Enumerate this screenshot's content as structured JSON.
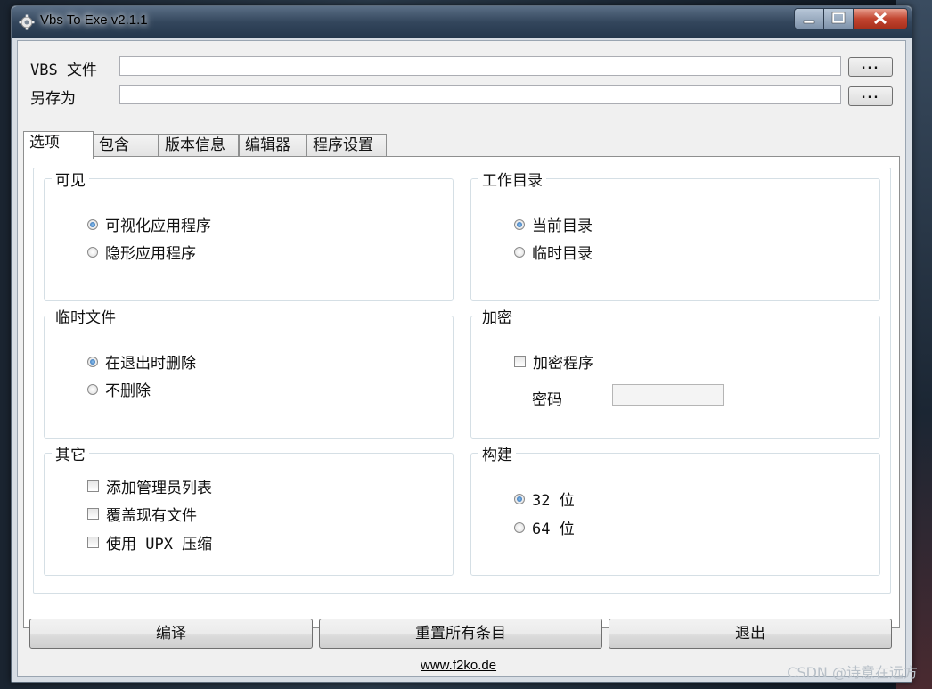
{
  "window": {
    "title": "Vbs To Exe v2.1.1"
  },
  "files": {
    "vbs_label": "VBS 文件",
    "vbs_value": "",
    "saveas_label": "另存为",
    "saveas_value": "",
    "browse_label": "..."
  },
  "tabs": [
    {
      "label": "选项"
    },
    {
      "label": "包含"
    },
    {
      "label": "版本信息"
    },
    {
      "label": "编辑器"
    },
    {
      "label": "程序设置"
    }
  ],
  "groups": {
    "visible": {
      "title": "可见",
      "options": [
        {
          "label": "可视化应用程序",
          "checked": true
        },
        {
          "label": "隐形应用程序",
          "checked": false
        }
      ]
    },
    "workdir": {
      "title": "工作目录",
      "options": [
        {
          "label": "当前目录",
          "checked": true
        },
        {
          "label": "临时目录",
          "checked": false
        }
      ]
    },
    "tempfile": {
      "title": "临时文件",
      "options": [
        {
          "label": "在退出时删除",
          "checked": true
        },
        {
          "label": "不删除",
          "checked": false
        }
      ]
    },
    "encrypt": {
      "title": "加密",
      "checkbox_label": "加密程序",
      "password_label": "密码",
      "password_value": ""
    },
    "other": {
      "title": "其它",
      "options": [
        {
          "label": "添加管理员列表"
        },
        {
          "label": "覆盖现有文件"
        },
        {
          "label": "使用 UPX 压缩"
        }
      ]
    },
    "build": {
      "title": "构建",
      "options": [
        {
          "label": "32 位",
          "checked": true
        },
        {
          "label": "64 位",
          "checked": false
        }
      ]
    }
  },
  "buttons": {
    "compile": "编译",
    "reset": "重置所有条目",
    "exit": "退出"
  },
  "footer": {
    "link": "www.f2ko.de"
  },
  "watermark": "CSDN @诗意在远方"
}
